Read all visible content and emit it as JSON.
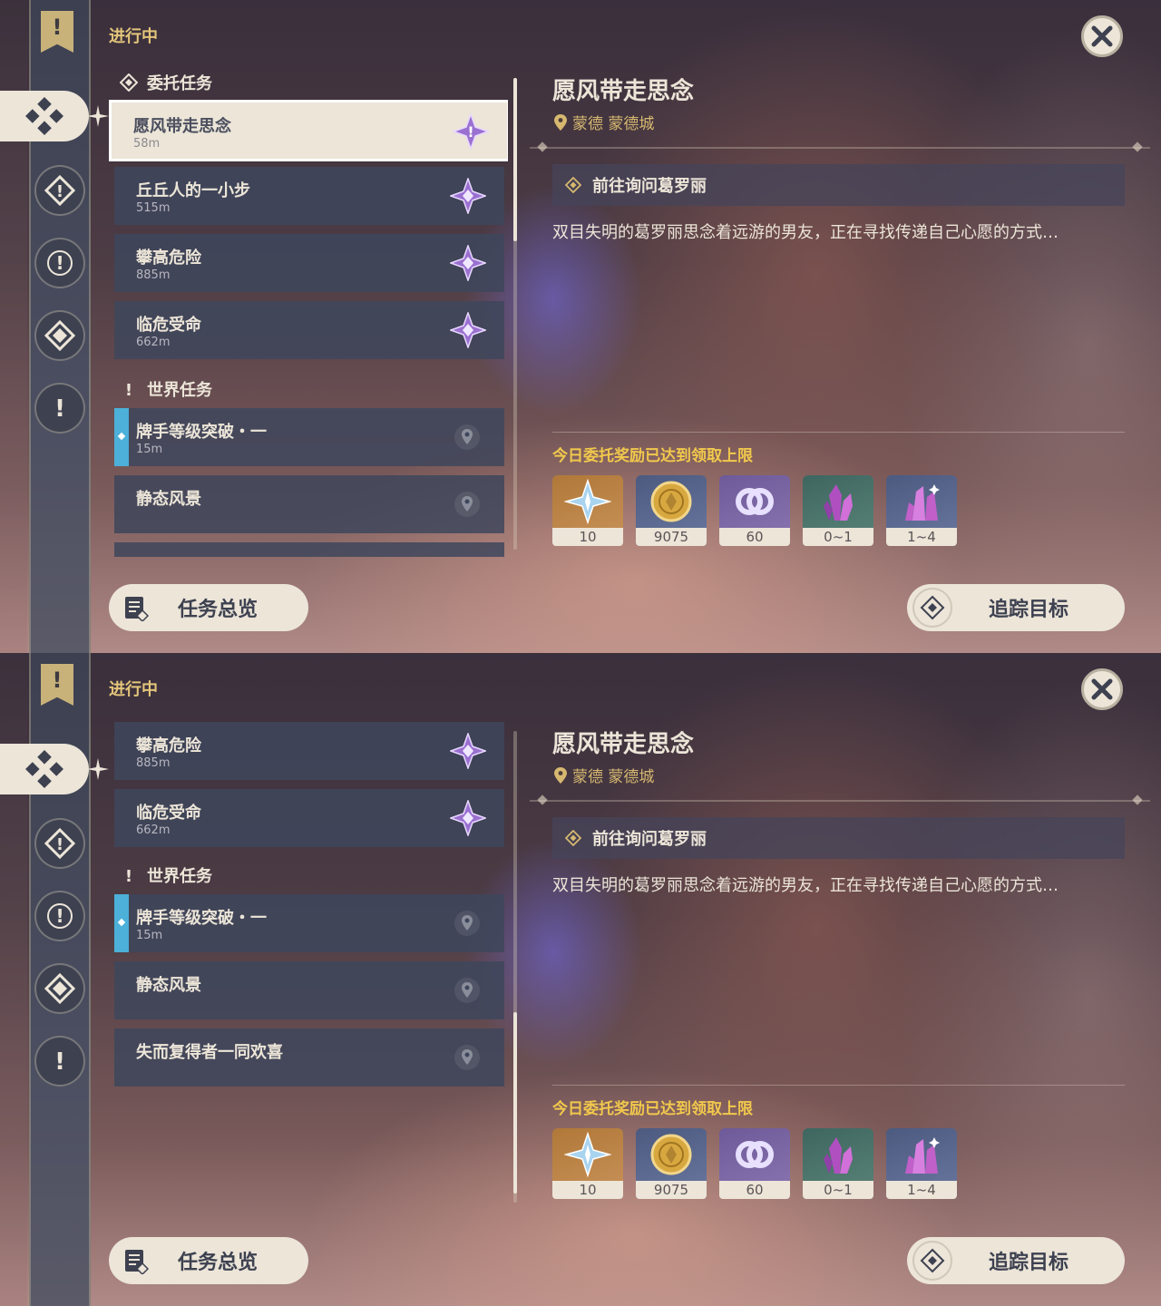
{
  "section_title": "进行中",
  "categories": {
    "commission": "委托任务",
    "world": "世界任务"
  },
  "quests": [
    {
      "name": "愿风带走思念",
      "distance": "58m"
    },
    {
      "name": "丘丘人的一小步",
      "distance": "515m"
    },
    {
      "name": "攀高危险",
      "distance": "885m"
    },
    {
      "name": "临危受命",
      "distance": "662m"
    },
    {
      "name": "牌手等级突破・一",
      "distance": "15m"
    },
    {
      "name": "静态风景",
      "distance": ""
    },
    {
      "name": "失而复得者一同欢喜",
      "distance": ""
    }
  ],
  "detail": {
    "title": "愿风带走思念",
    "location": "蒙德 蒙德城",
    "objective": "前往询问葛罗丽",
    "description": "双目失明的葛罗丽思念着远游的男友，正在寻找传递自己心愿的方式…",
    "reward_note": "今日委托奖励已达到领取上限",
    "rewards": [
      {
        "item": "primogem-icon",
        "qty": "10"
      },
      {
        "item": "mora-icon",
        "qty": "9075"
      },
      {
        "item": "friendship-icon",
        "qty": "60"
      },
      {
        "item": "crystal-icon",
        "qty": "0~1"
      },
      {
        "item": "crystal-cluster-icon",
        "qty": "1~4"
      }
    ]
  },
  "buttons": {
    "overview": "任务总览",
    "track": "追踪目标"
  },
  "colors": {
    "accent_gold": "#e3c57a",
    "reward_note": "#f1c84c",
    "tracked_bar": "#4cb0d8",
    "panel_cream": "#ece5d8"
  },
  "scroll_progress": {
    "top": 0.0,
    "bottom": 0.55
  }
}
